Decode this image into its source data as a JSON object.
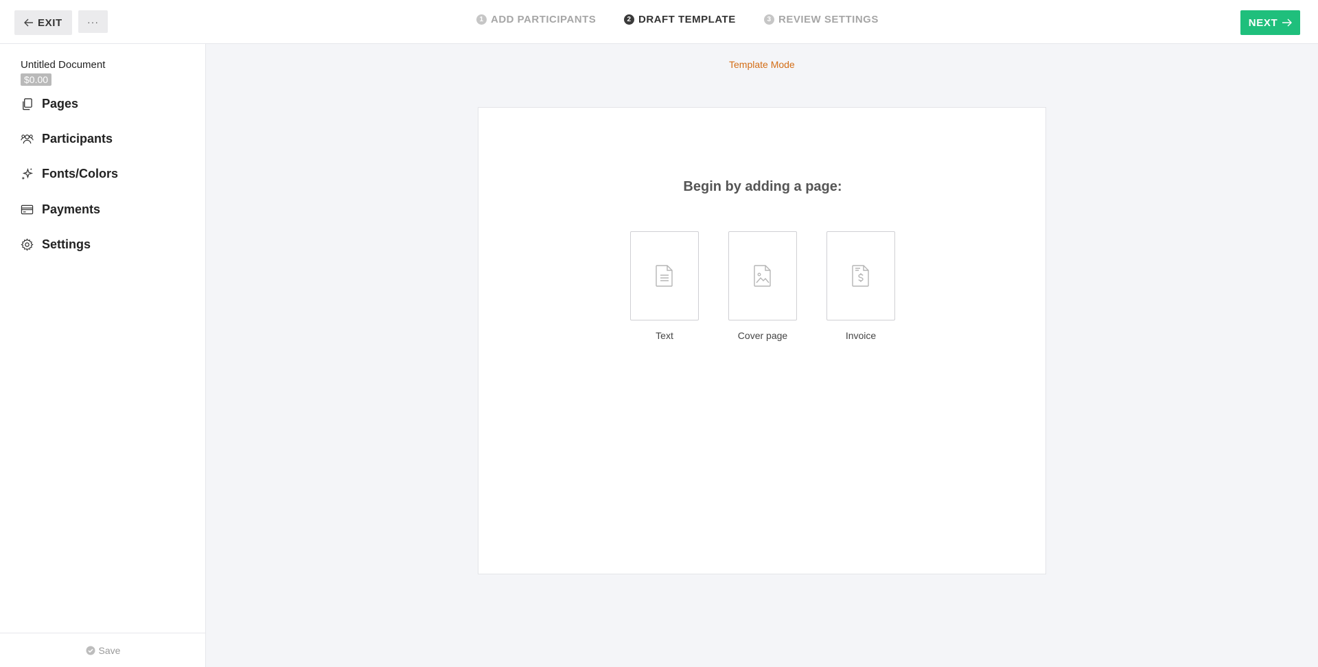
{
  "topbar": {
    "exit_label": "EXIT",
    "more_label": "···",
    "steps": [
      {
        "num": "1",
        "label": "ADD PARTICIPANTS"
      },
      {
        "num": "2",
        "label": "DRAFT TEMPLATE"
      },
      {
        "num": "3",
        "label": "REVIEW SETTINGS"
      }
    ],
    "next_label": "NEXT"
  },
  "sidebar": {
    "doc_title": "Untitled Document",
    "doc_price": "$0.00",
    "items": [
      {
        "label": "Pages",
        "icon": "pages-icon"
      },
      {
        "label": "Participants",
        "icon": "participants-icon"
      },
      {
        "label": "Fonts/Colors",
        "icon": "sparkle-icon"
      },
      {
        "label": "Payments",
        "icon": "credit-card-icon"
      },
      {
        "label": "Settings",
        "icon": "gear-icon"
      }
    ],
    "save_label": "Save"
  },
  "main": {
    "mode_label": "Template Mode",
    "heading": "Begin by adding a page:",
    "tiles": [
      {
        "label": "Text",
        "icon": "text-document-icon"
      },
      {
        "label": "Cover page",
        "icon": "image-document-icon"
      },
      {
        "label": "Invoice",
        "icon": "invoice-document-icon"
      }
    ]
  },
  "colors": {
    "accent_green": "#1fbf7c",
    "mode_orange": "#d36d16",
    "background": "#f4f5f8"
  }
}
